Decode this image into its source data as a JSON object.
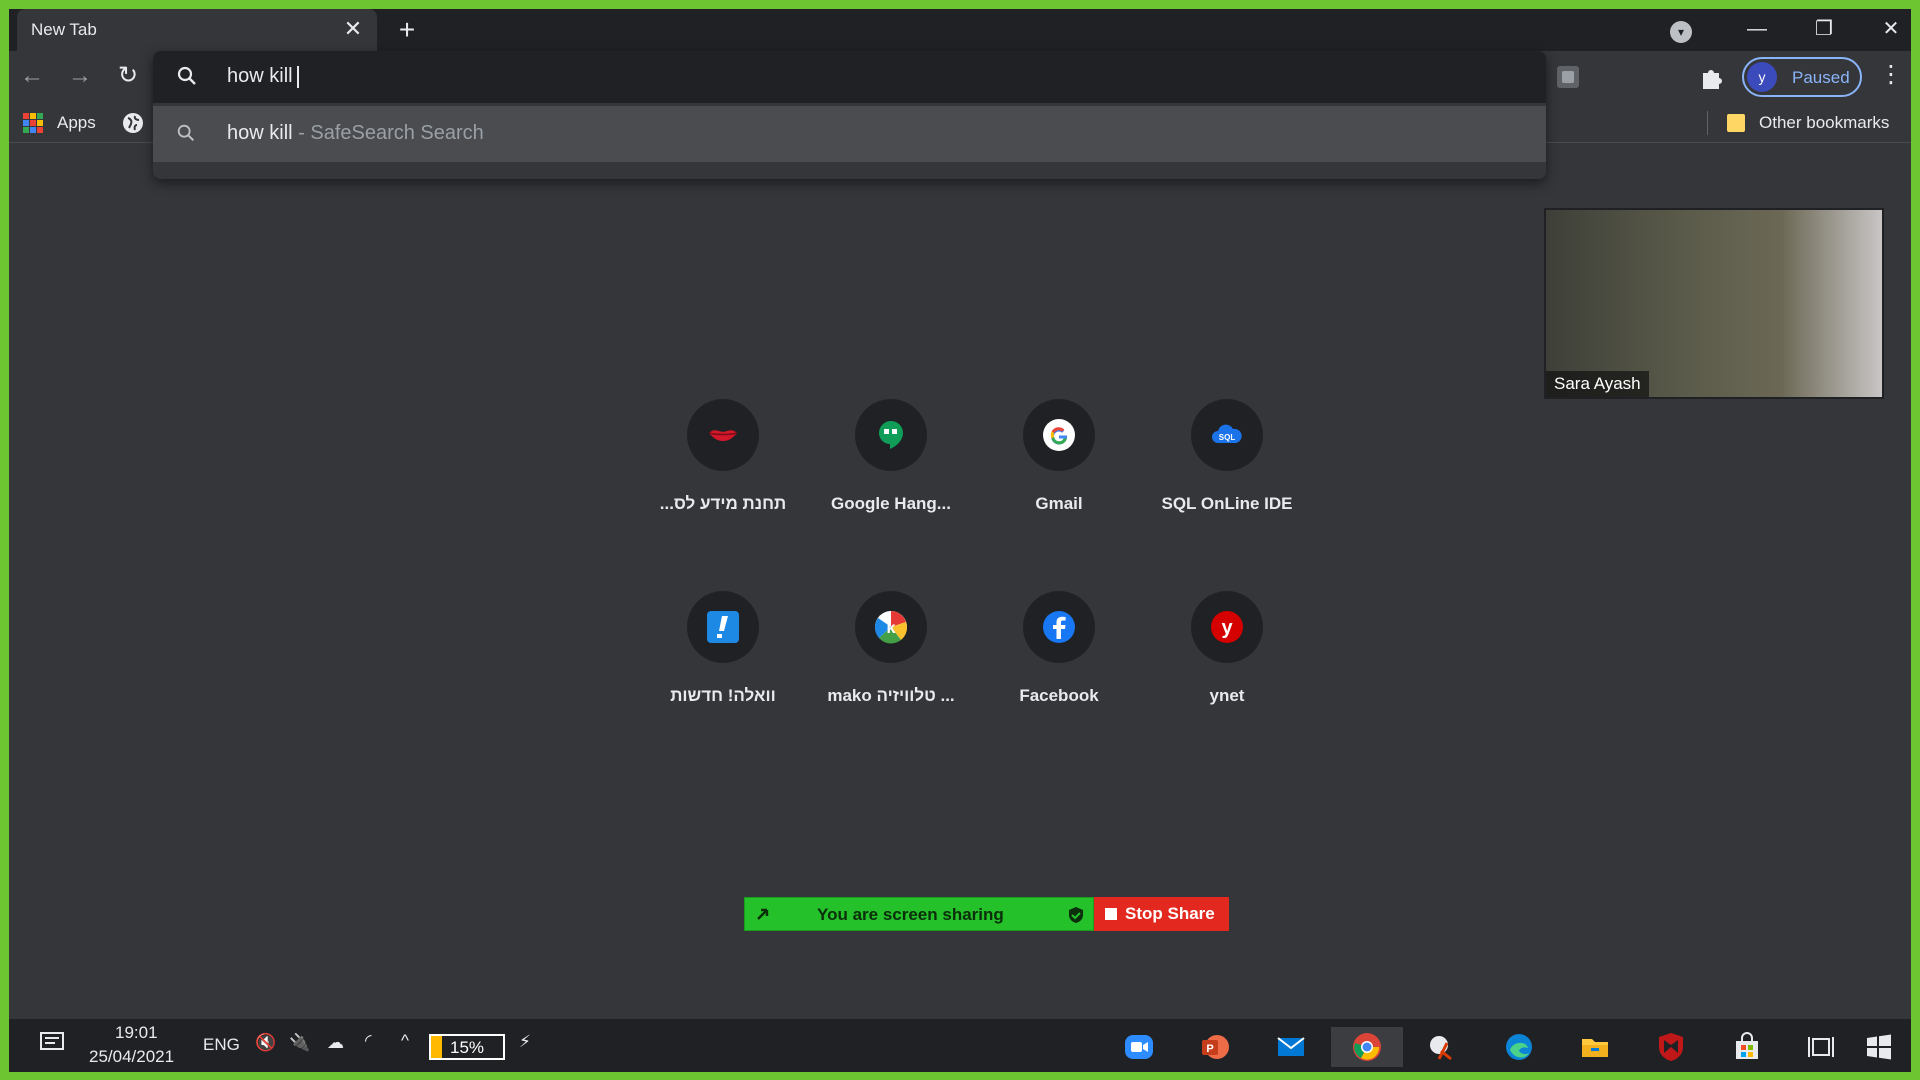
{
  "browser": {
    "tab_title": "New Tab",
    "tab_close": "✕",
    "new_tab": "+",
    "window_controls": {
      "minimize": "—",
      "restore": "❐",
      "close": "✕"
    },
    "profile": {
      "initial": "y",
      "label": "Paused"
    }
  },
  "omnibox": {
    "value": "how kill",
    "suggestion_query": "how kill",
    "suggestion_sub": " - SafeSearch Search"
  },
  "bookmarks": {
    "apps_label": "Apps",
    "other_label": "Other bookmarks"
  },
  "shortcuts": [
    {
      "label": "...תחנת מידע לס",
      "icon": "lips-icon"
    },
    {
      "label": "Google Hang...",
      "icon": "hangouts-icon"
    },
    {
      "label": "Gmail",
      "icon": "google-icon"
    },
    {
      "label": "SQL OnLine IDE",
      "icon": "sql-cloud-icon"
    },
    {
      "label": "וואלה! חדשות",
      "icon": "walla-icon"
    },
    {
      "label": "mako טלוויזיה ...",
      "icon": "mako-icon"
    },
    {
      "label": "Facebook",
      "icon": "facebook-icon"
    },
    {
      "label": "ynet",
      "icon": "ynet-icon"
    }
  ],
  "video": {
    "participant_name": "Sara Ayash"
  },
  "screen_share": {
    "status_text": "You are screen sharing",
    "stop_label": "Stop Share"
  },
  "taskbar": {
    "time": "19:01",
    "date": "25/04/2021",
    "language": "ENG",
    "battery_text": "15%",
    "battery_level": 0.15
  },
  "colors": {
    "frame_border": "#6cc531",
    "share_green": "#24c12b",
    "share_red": "#e3281f",
    "profile_accent": "#8ab4f8"
  }
}
